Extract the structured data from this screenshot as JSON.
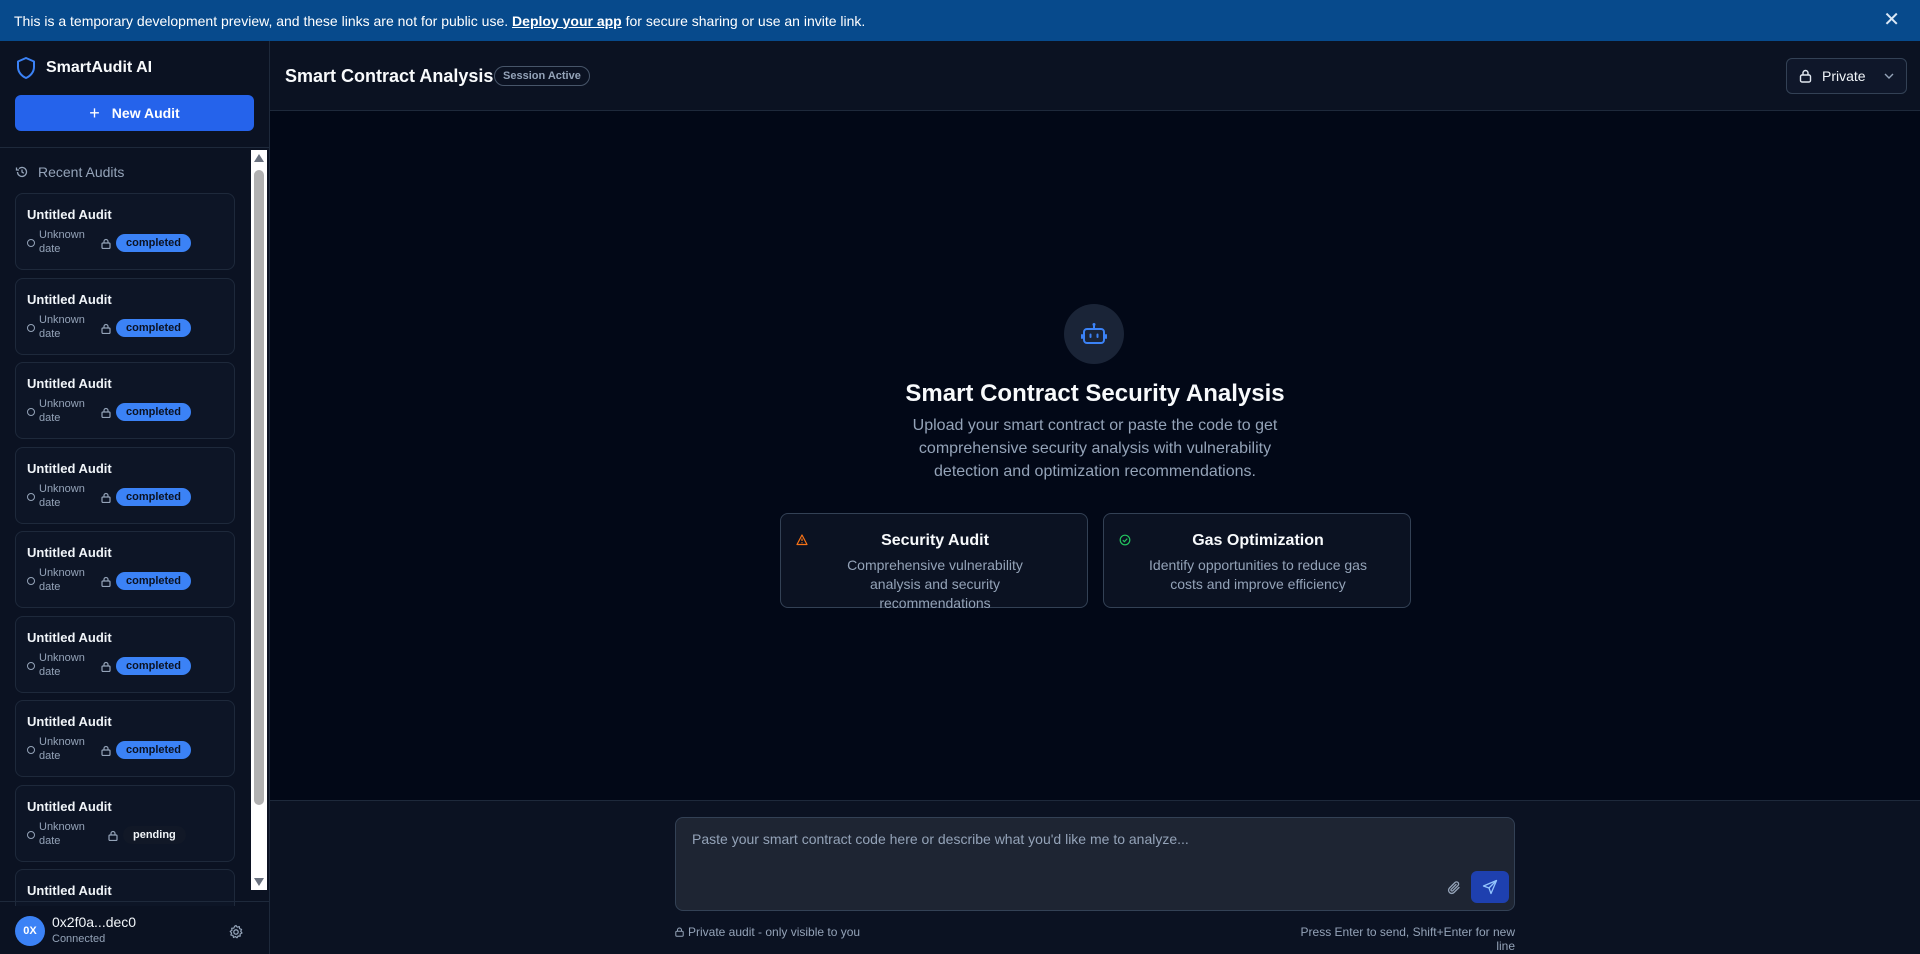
{
  "banner": {
    "text_before": "This is a temporary development preview, and these links are not for public use.",
    "link": "Deploy your app",
    "text_after": "for secure sharing or use an invite link.",
    "close": "✕"
  },
  "sidebar": {
    "brand": "SmartAudit AI",
    "new_audit_label": "New Audit",
    "recent_label": "Recent Audits",
    "audits": [
      {
        "title": "Untitled Audit",
        "date": "Unknown date",
        "status": "completed"
      },
      {
        "title": "Untitled Audit",
        "date": "Unknown date",
        "status": "completed"
      },
      {
        "title": "Untitled Audit",
        "date": "Unknown date",
        "status": "completed"
      },
      {
        "title": "Untitled Audit",
        "date": "Unknown date",
        "status": "completed"
      },
      {
        "title": "Untitled Audit",
        "date": "Unknown date",
        "status": "completed"
      },
      {
        "title": "Untitled Audit",
        "date": "Unknown date",
        "status": "completed"
      },
      {
        "title": "Untitled Audit",
        "date": "Unknown date",
        "status": "completed"
      },
      {
        "title": "Untitled Audit",
        "date": "Unknown date",
        "status": "pending"
      },
      {
        "title": "Untitled Audit",
        "date": "",
        "status": ""
      }
    ],
    "user": {
      "initials": "0X",
      "wallet": "0x2f0a...dec0",
      "status": "Connected"
    }
  },
  "header": {
    "title": "Smart Contract Analysis",
    "session_badge": "Session Active",
    "visibility": "Private"
  },
  "hero": {
    "title": "Smart Contract Security Analysis",
    "description": "Upload your smart contract or paste the code to get comprehensive security analysis with vulnerability detection and optimization recommendations."
  },
  "features": [
    {
      "title": "Security Audit",
      "description": "Comprehensive vulnerability analysis and security recommendations",
      "icon": "warning-icon"
    },
    {
      "title": "Gas Optimization",
      "description": "Identify opportunities to reduce gas costs and improve efficiency",
      "icon": "check-circle-icon"
    }
  ],
  "composer": {
    "placeholder": "Paste your smart contract code here or describe what you'd like me to analyze...",
    "privacy_note": "Private audit - only visible to you",
    "hint": "Press Enter to send, Shift+Enter for new line"
  },
  "colors": {
    "accent": "#2563eb",
    "badge_completed": "#3b82f6",
    "warning": "#f97316",
    "success": "#22c55e",
    "banner": "#074a8c"
  }
}
